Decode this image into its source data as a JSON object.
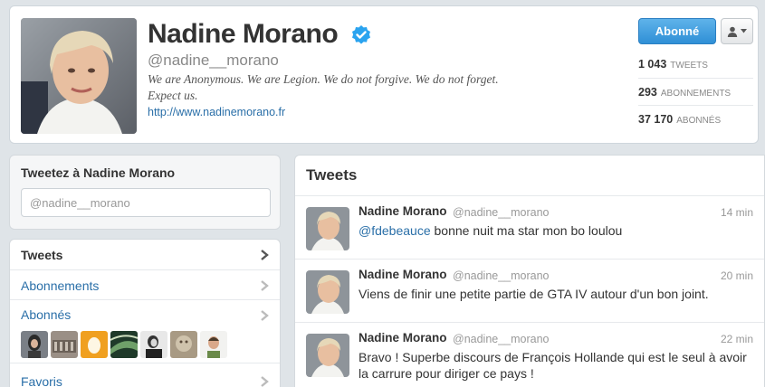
{
  "profile": {
    "name": "Nadine Morano",
    "handle": "@nadine__morano",
    "bio": "We are Anonymous. We are Legion. We do not forgive. We do not forget. Expect us.",
    "url": "http://www.nadinemorano.fr",
    "follow_label": "Abonné",
    "stats": [
      {
        "value": "1 043",
        "label": "TWEETS"
      },
      {
        "value": "293",
        "label": "ABONNEMENTS"
      },
      {
        "value": "37 170",
        "label": "ABONNÉS"
      }
    ]
  },
  "tweet_to": {
    "title": "Tweetez à Nadine Morano",
    "input_value": "@nadine__morano"
  },
  "nav": {
    "items": [
      {
        "label": "Tweets"
      },
      {
        "label": "Abonnements"
      },
      {
        "label": "Abonnés"
      },
      {
        "label": "Favoris"
      }
    ]
  },
  "tweets": {
    "title": "Tweets",
    "items": [
      {
        "name": "Nadine Morano",
        "handle": "@nadine__morano",
        "time": "14 min",
        "mention": "@fdebeauce",
        "text": " bonne nuit ma star mon bo loulou"
      },
      {
        "name": "Nadine Morano",
        "handle": "@nadine__morano",
        "time": "20 min",
        "mention": "",
        "text": "Viens de finir une petite partie de GTA IV autour d'un bon joint."
      },
      {
        "name": "Nadine Morano",
        "handle": "@nadine__morano",
        "time": "22 min",
        "mention": "",
        "text": "Bravo ! Superbe discours de François Hollande qui est le seul à avoir la carrure pour diriger ce pays !"
      }
    ]
  },
  "colors": {
    "link": "#2a6fa8",
    "follow_button": "#3c9be0",
    "verified": "#2aa3ef"
  }
}
